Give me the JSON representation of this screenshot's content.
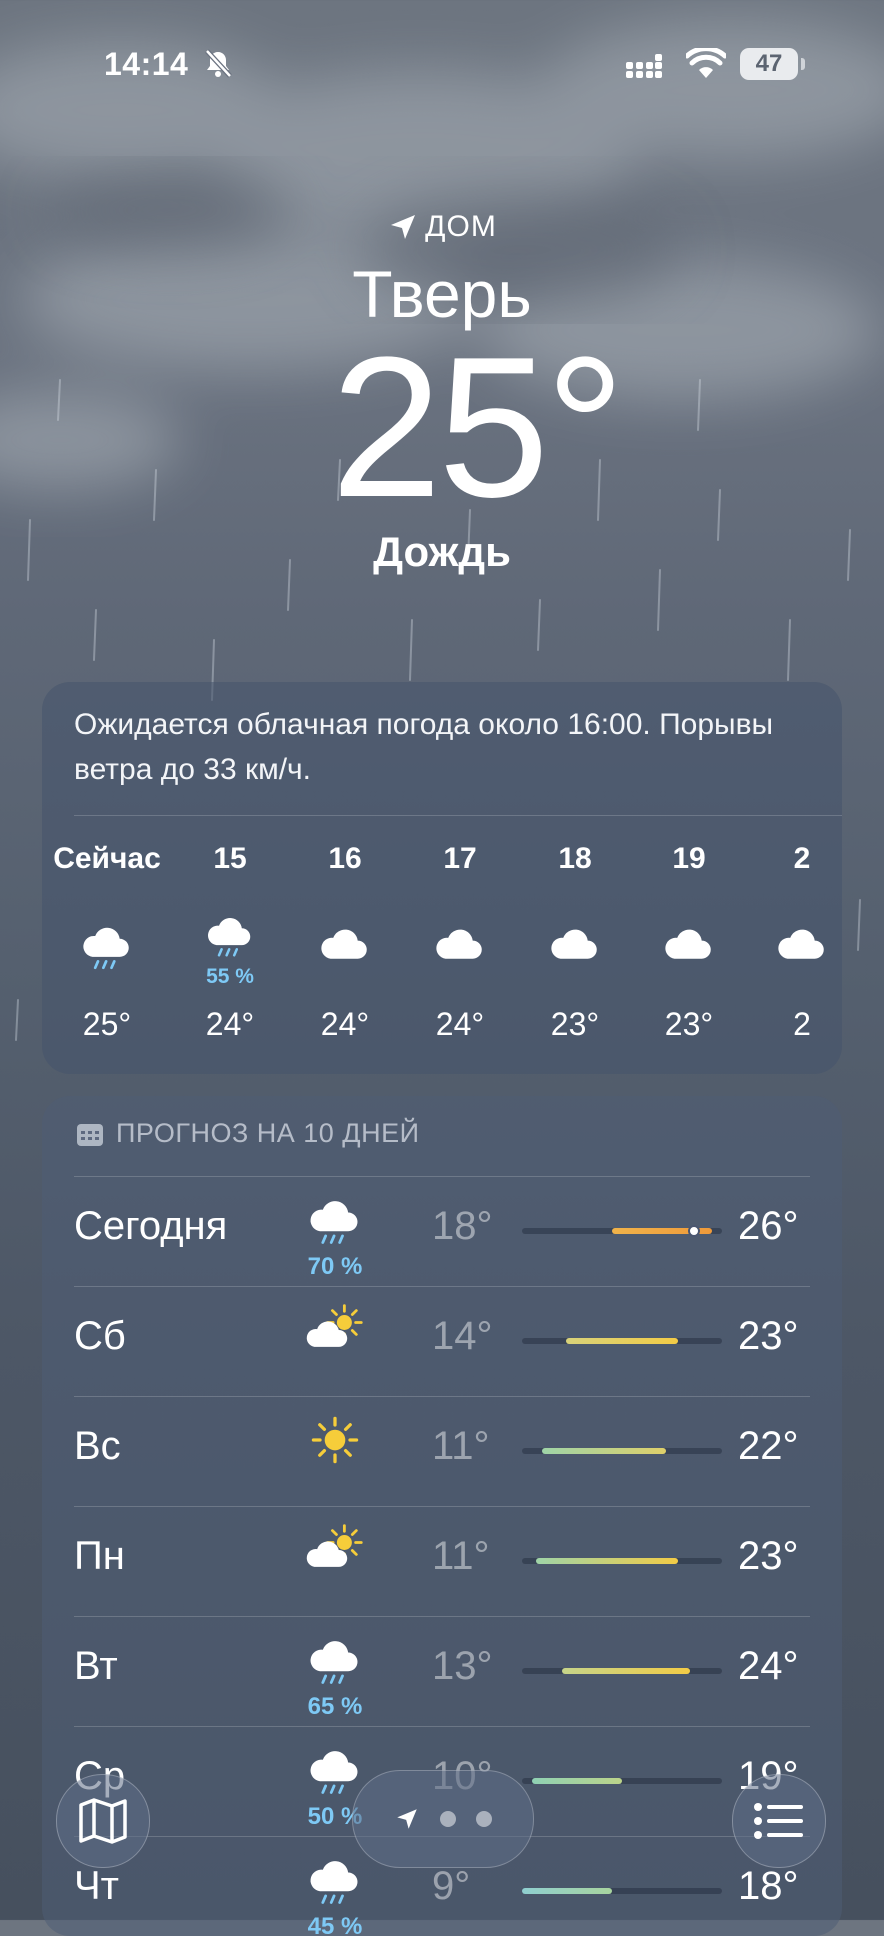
{
  "status_bar": {
    "time": "14:14",
    "battery": "47"
  },
  "location": {
    "label": "ДОМ",
    "city": "Тверь",
    "temperature": "25°",
    "condition": "Дождь"
  },
  "hourly": {
    "summary": "Ожидается облачная погода около 16:00. Порывы ветра до 33 км/ч.",
    "hours": [
      {
        "label": "Сейчас",
        "icon": "cloud-rain-icon",
        "precip": "",
        "temp": "25°"
      },
      {
        "label": "15",
        "icon": "cloud-rain-icon",
        "precip": "55 %",
        "temp": "24°"
      },
      {
        "label": "16",
        "icon": "cloud-icon",
        "precip": "",
        "temp": "24°"
      },
      {
        "label": "17",
        "icon": "cloud-icon",
        "precip": "",
        "temp": "24°"
      },
      {
        "label": "18",
        "icon": "cloud-icon",
        "precip": "",
        "temp": "23°"
      },
      {
        "label": "19",
        "icon": "cloud-icon",
        "precip": "",
        "temp": "23°"
      },
      {
        "label": "2",
        "icon": "cloud-icon",
        "precip": "",
        "temp": "2"
      }
    ]
  },
  "daily": {
    "title": "ПРОГНОЗ НА 10 ДНЕЙ",
    "days": [
      {
        "name": "Сегодня",
        "icon": "cloud-rain-icon",
        "precip": "70 %",
        "low": "18°",
        "high": "26°",
        "bar_from": 0.45,
        "bar_to": 0.95,
        "colors": [
          "#f0b34a",
          "#ef9a3a"
        ],
        "current": 0.86
      },
      {
        "name": "Сб",
        "icon": "sun-cloud-icon",
        "precip": "",
        "low": "14°",
        "high": "23°",
        "bar_from": 0.22,
        "bar_to": 0.78,
        "colors": [
          "#d8d27a",
          "#f3cc46"
        ]
      },
      {
        "name": "Вс",
        "icon": "sun-icon",
        "precip": "",
        "low": "11°",
        "high": "22°",
        "bar_from": 0.1,
        "bar_to": 0.72,
        "colors": [
          "#9fd4a8",
          "#dfd06a"
        ]
      },
      {
        "name": "Пн",
        "icon": "sun-cloud-icon",
        "precip": "",
        "low": "11°",
        "high": "23°",
        "bar_from": 0.07,
        "bar_to": 0.78,
        "colors": [
          "#9fd4a8",
          "#f3cc46"
        ]
      },
      {
        "name": "Вт",
        "icon": "cloud-rain-icon",
        "precip": "65 %",
        "low": "13°",
        "high": "24°",
        "bar_from": 0.2,
        "bar_to": 0.84,
        "colors": [
          "#c6d48a",
          "#f3cc46"
        ]
      },
      {
        "name": "Ср",
        "icon": "cloud-rain-icon",
        "precip": "50 %",
        "low": "10°",
        "high": "19°",
        "bar_from": 0.05,
        "bar_to": 0.5,
        "colors": [
          "#8fd1b4",
          "#bcd48a"
        ]
      },
      {
        "name": "Чт",
        "icon": "cloud-rain-icon",
        "precip": "45 %",
        "low": "9°",
        "high": "18°",
        "bar_from": 0.0,
        "bar_to": 0.45,
        "colors": [
          "#8fcfd0",
          "#a8d49e"
        ]
      }
    ]
  },
  "toolbar": {
    "map": "map-icon",
    "location": "location-arrow-icon",
    "list": "list-icon"
  }
}
